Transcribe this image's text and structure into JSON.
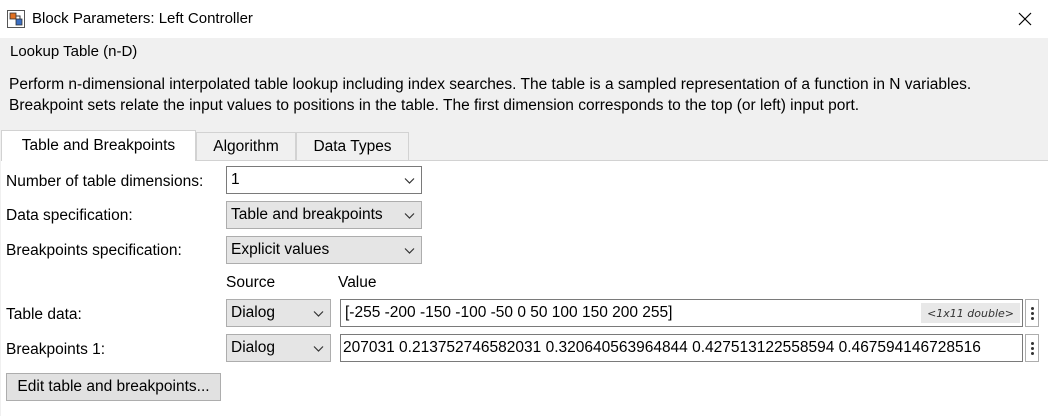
{
  "window": {
    "title": "Block Parameters: Left Controller",
    "app_icon": "simulink-block-icon",
    "close_icon": "close-icon"
  },
  "section": {
    "legend": "Lookup Table (n-D)",
    "description": "Perform n-dimensional interpolated table lookup including index searches. The table is a sampled representation of a function in N variables. Breakpoint sets relate the input values to positions in the table. The first dimension corresponds to the top (or left) input port."
  },
  "tabs": [
    {
      "label": "Table and Breakpoints",
      "active": true
    },
    {
      "label": "Algorithm",
      "active": false
    },
    {
      "label": "Data Types",
      "active": false
    }
  ],
  "form": {
    "num_dims_label": "Number of table dimensions:",
    "num_dims_value": "1",
    "data_spec_label": "Data specification:",
    "data_spec_value": "Table and breakpoints",
    "bp_spec_label": "Breakpoints specification:",
    "bp_spec_value": "Explicit values",
    "source_header": "Source",
    "value_header": "Value",
    "table_data": {
      "label": "Table data:",
      "source": "Dialog",
      "value": "[-255 -200 -150 -100 -50 0 50 100 150 200 255]",
      "size_badge": "<1x11 double>"
    },
    "breakpoints1": {
      "label": "Breakpoints 1:",
      "source": "Dialog",
      "value": "207031 0.213752746582031 0.320640563964844 0.427513122558594 0.467594146728516"
    },
    "edit_button": "Edit table and breakpoints..."
  },
  "colors": {
    "panel_bg": "#ffffff",
    "dialog_bg": "#f0f0f0",
    "combo_gray": "#e5e5e5"
  }
}
